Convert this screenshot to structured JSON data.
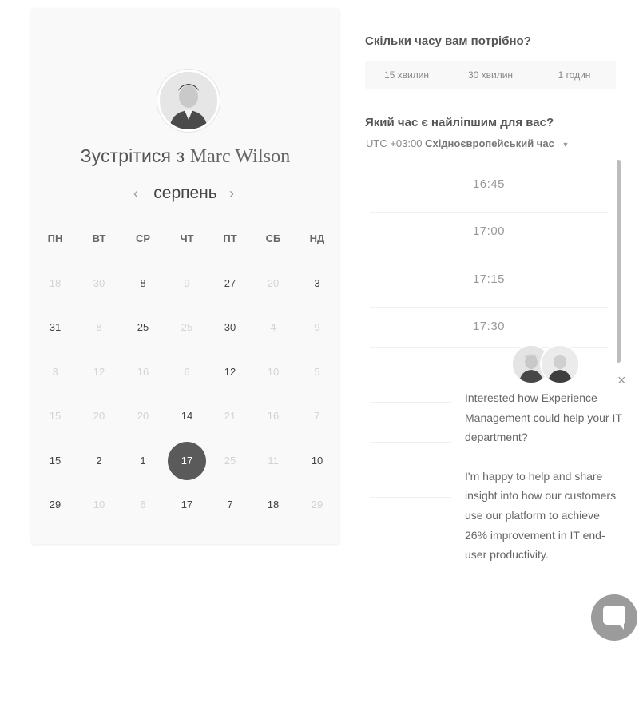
{
  "scheduler": {
    "title_prefix": "Зустрітися з",
    "host_name": "Marc Wilson",
    "month": "серпень",
    "prev_arrow": "‹",
    "next_arrow": "›",
    "weekdays": [
      "ПН",
      "ВТ",
      "СР",
      "ЧТ",
      "ПТ",
      "СБ",
      "НД"
    ],
    "weeks": [
      [
        {
          "d": "18",
          "a": false
        },
        {
          "d": "30",
          "a": false
        },
        {
          "d": "8",
          "a": true
        },
        {
          "d": "9",
          "a": false
        },
        {
          "d": "27",
          "a": true
        },
        {
          "d": "20",
          "a": false
        },
        {
          "d": "3",
          "a": true
        }
      ],
      [
        {
          "d": "31",
          "a": true
        },
        {
          "d": "8",
          "a": false
        },
        {
          "d": "25",
          "a": true
        },
        {
          "d": "25",
          "a": false
        },
        {
          "d": "30",
          "a": true
        },
        {
          "d": "4",
          "a": false
        },
        {
          "d": "9",
          "a": false
        }
      ],
      [
        {
          "d": "3",
          "a": false
        },
        {
          "d": "12",
          "a": false
        },
        {
          "d": "16",
          "a": false
        },
        {
          "d": "6",
          "a": false
        },
        {
          "d": "12",
          "a": true
        },
        {
          "d": "10",
          "a": false
        },
        {
          "d": "5",
          "a": false
        }
      ],
      [
        {
          "d": "15",
          "a": false
        },
        {
          "d": "20",
          "a": false
        },
        {
          "d": "20",
          "a": false
        },
        {
          "d": "14",
          "a": true
        },
        {
          "d": "21",
          "a": false
        },
        {
          "d": "16",
          "a": false
        },
        {
          "d": "7",
          "a": false
        }
      ],
      [
        {
          "d": "15",
          "a": true
        },
        {
          "d": "2",
          "a": true
        },
        {
          "d": "1",
          "a": true
        },
        {
          "d": "17",
          "a": true,
          "selected": true
        },
        {
          "d": "25",
          "a": false
        },
        {
          "d": "11",
          "a": false
        },
        {
          "d": "10",
          "a": true
        }
      ],
      [
        {
          "d": "29",
          "a": true
        },
        {
          "d": "10",
          "a": false
        },
        {
          "d": "6",
          "a": false
        },
        {
          "d": "17",
          "a": true
        },
        {
          "d": "7",
          "a": true
        },
        {
          "d": "18",
          "a": true
        },
        {
          "d": "29",
          "a": false
        }
      ]
    ]
  },
  "booking": {
    "duration_question": "Скільки часу вам потрібно?",
    "durations": [
      "15 хвилин",
      "30 хвилин",
      "1 годин"
    ],
    "time_question": "Який час є найліпшим для вас?",
    "timezone_offset": "UTC +03:00",
    "timezone_name": "Східноєвропейський час",
    "slots": [
      "16:45",
      "17:00",
      "17:15",
      "17:30"
    ]
  },
  "chat": {
    "message_1": "Interested how Experience Management could help your IT department?",
    "message_2": "I'm happy to help and share insight into how our customers use our platform to achieve 26% improvement in IT end-user productivity.",
    "close": "×"
  }
}
